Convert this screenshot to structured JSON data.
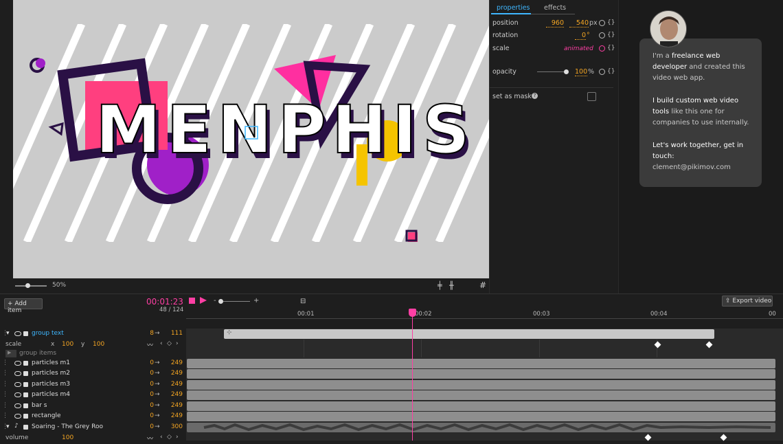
{
  "canvas": {
    "title_text": "MENPHIS",
    "zoom": "50%"
  },
  "properties": {
    "tabs": [
      "properties",
      "effects"
    ],
    "position_label": "position",
    "position_x": "960",
    "position_y": "540",
    "position_unit": "px",
    "rotation_label": "rotation",
    "rotation_value": "0",
    "rotation_unit": "°",
    "scale_label": "scale",
    "scale_value": "animated",
    "opacity_label": "opacity",
    "opacity_value": "100",
    "opacity_unit": "%",
    "opacity_level": 1.0,
    "mask_label": "set as mask",
    "braces": "{}"
  },
  "info": {
    "p1_a": "I'm a ",
    "p1_b": "freelance web developer",
    "p1_c": " and created this video web app.",
    "p2_a": "I build custom web video tools",
    "p2_b": " like this one for companies to use internally.",
    "p3_a": "Let's work together, get in touch:",
    "email": "clement@pikimov.com"
  },
  "timeline": {
    "add_item": "Add item",
    "timecode": "00:01:23",
    "frames": "48 / 124",
    "export": "Export video",
    "ticks": [
      "00:01",
      "00:02",
      "00:03",
      "00:04",
      "00"
    ],
    "group": {
      "name": "group text",
      "in": "8",
      "out": "111"
    },
    "scale_row": {
      "label": "scale",
      "x_label": "x",
      "x": "100",
      "y_label": "y",
      "y": "100"
    },
    "group_items": "group items",
    "layers": [
      {
        "name": "particles m1",
        "in": "0",
        "out": "249"
      },
      {
        "name": "particles m2",
        "in": "0",
        "out": "249"
      },
      {
        "name": "particles m3",
        "in": "0",
        "out": "249"
      },
      {
        "name": "particles m4",
        "in": "0",
        "out": "249"
      },
      {
        "name": "bar s",
        "in": "0",
        "out": "249"
      },
      {
        "name": "rectangle",
        "in": "0",
        "out": "249"
      },
      {
        "name": "Soaring - The Grey Roo",
        "in": "0",
        "out": "300"
      }
    ],
    "volume_label": "volume",
    "volume_value": "100",
    "arrow": "→"
  },
  "colors": {
    "accent": "#ff3fa4",
    "value": "#f5a623",
    "tab": "#3fb7ff"
  }
}
